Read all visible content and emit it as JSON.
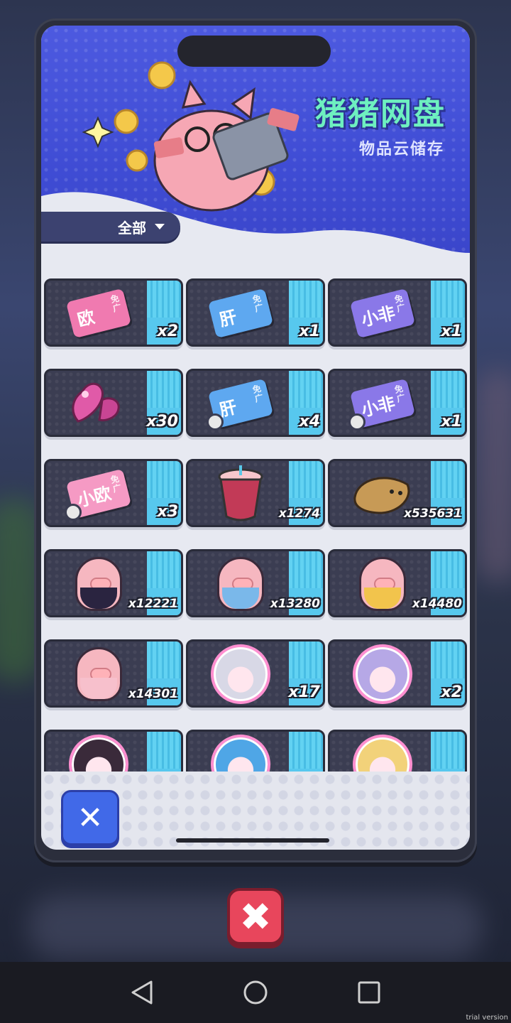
{
  "app": {
    "title": "猪猪网盘",
    "subtitle": "物品云储存"
  },
  "filter": {
    "label": "全部"
  },
  "items": [
    {
      "kind": "ticket",
      "label": "欧",
      "tag": "免广",
      "color": "#f07ab0",
      "count": "x2"
    },
    {
      "kind": "ticket",
      "label": "肝",
      "tag": "免广",
      "color": "#5ea8f0",
      "count": "x1"
    },
    {
      "kind": "ticket",
      "label": "小非",
      "tag": "免广",
      "color": "#8a78e8",
      "count": "x1"
    },
    {
      "kind": "heart-gem",
      "count": "x30"
    },
    {
      "kind": "ticket",
      "label": "肝",
      "tag": "免广",
      "color": "#5ea8f0",
      "count": "x4",
      "puzzle": true
    },
    {
      "kind": "ticket",
      "label": "小非",
      "tag": "免广",
      "color": "#8a78e8",
      "count": "x1",
      "puzzle": true
    },
    {
      "kind": "ticket",
      "label": "小欧",
      "tag": "免广",
      "color": "#f59ac4",
      "count": "x3",
      "puzzle": true
    },
    {
      "kind": "drink-cup",
      "count": "x1274"
    },
    {
      "kind": "croissant",
      "count": "x535631"
    },
    {
      "kind": "pig-purple",
      "count": "x12221"
    },
    {
      "kind": "pig-blue",
      "count": "x13280"
    },
    {
      "kind": "pig-yellow",
      "count": "x14480"
    },
    {
      "kind": "pig-pink",
      "count": "x14301"
    },
    {
      "kind": "avatar-silver",
      "count": "x17"
    },
    {
      "kind": "avatar-lavender",
      "count": "x2"
    },
    {
      "kind": "avatar-dark",
      "count": ""
    },
    {
      "kind": "avatar-blue",
      "count": ""
    },
    {
      "kind": "avatar-blonde",
      "count": ""
    }
  ],
  "buttons": {
    "close_inner": "✕",
    "close_outer": "✖"
  },
  "watermark": "trial version",
  "colors": {
    "header": "#4350d8",
    "title": "#6ef0c0",
    "close_blue": "#4169e8",
    "close_red": "#e8465c"
  }
}
